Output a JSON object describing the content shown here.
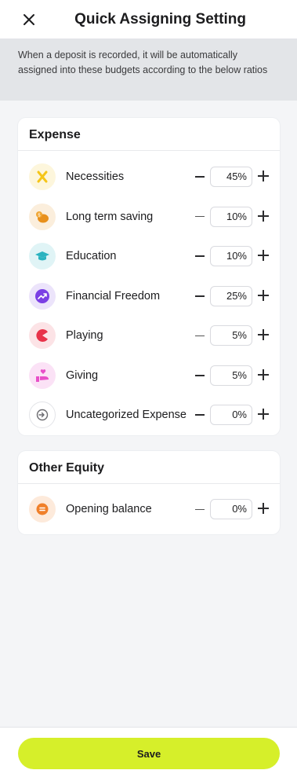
{
  "header": {
    "title": "Quick Assigning Setting",
    "close_icon": "close-icon"
  },
  "notice": {
    "text": "When a deposit is recorded, it will be automatically assigned into these budgets according to the below ratios"
  },
  "expense": {
    "title": "Expense",
    "items": [
      {
        "label": "Necessities",
        "value": "45%",
        "icon": "utensils-icon",
        "color": "#f5c518"
      },
      {
        "label": "Long term saving",
        "value": "10%",
        "icon": "piggy-bank-icon",
        "color": "#e8901c"
      },
      {
        "label": "Education",
        "value": "10%",
        "icon": "graduation-cap-icon",
        "color": "#2bb3c0"
      },
      {
        "label": "Financial Freedom",
        "value": "25%",
        "icon": "trend-up-icon",
        "color": "#7b3fe4"
      },
      {
        "label": "Playing",
        "value": "5%",
        "icon": "pacman-icon",
        "color": "#e8334a"
      },
      {
        "label": "Giving",
        "value": "5%",
        "icon": "heart-hand-icon",
        "color": "#e84fc8"
      },
      {
        "label": "Uncategorized Expense",
        "value": "0%",
        "icon": "login-circle-icon",
        "color": "#6b6b70"
      }
    ]
  },
  "other_equity": {
    "title": "Other Equity",
    "items": [
      {
        "label": "Opening balance",
        "value": "0%",
        "icon": "equal-coin-icon",
        "color": "#f0802a"
      }
    ]
  },
  "footer": {
    "save_label": "Save"
  },
  "colors": {
    "accent": "#d6ef2a",
    "background": "#f4f5f7",
    "notice_bg": "#e3e5e8"
  }
}
